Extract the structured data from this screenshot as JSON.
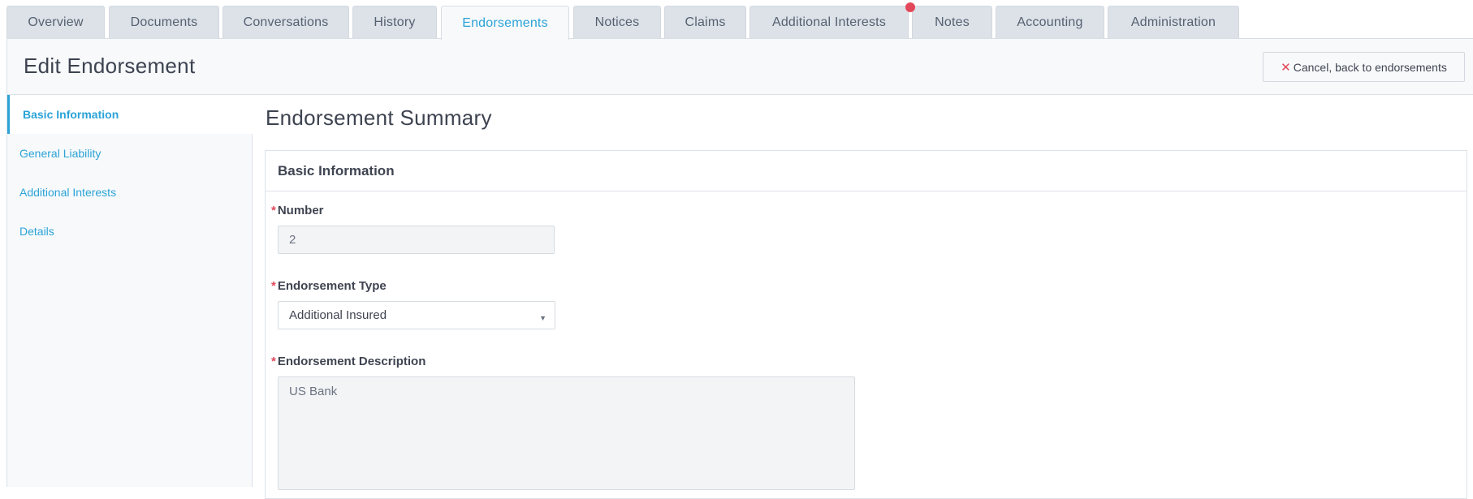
{
  "tabs": [
    {
      "label": "Overview"
    },
    {
      "label": "Documents"
    },
    {
      "label": "Conversations"
    },
    {
      "label": "History"
    },
    {
      "label": "Endorsements",
      "active": true
    },
    {
      "label": "Notices"
    },
    {
      "label": "Claims"
    },
    {
      "label": "Additional Interests",
      "notification": true
    },
    {
      "label": "Notes"
    },
    {
      "label": "Accounting"
    },
    {
      "label": "Administration"
    }
  ],
  "header": {
    "title": "Edit Endorsement",
    "cancel_icon": "close-icon",
    "cancel_label": "Cancel, back to endorsements"
  },
  "sidebar": {
    "items": [
      {
        "label": "Basic Information",
        "active": true
      },
      {
        "label": "General Liability"
      },
      {
        "label": "Additional Interests"
      },
      {
        "label": "Details"
      }
    ]
  },
  "main": {
    "title": "Endorsement Summary",
    "panel_title": "Basic Information",
    "fields": {
      "number": {
        "label": "Number",
        "value": "2",
        "required": true
      },
      "type": {
        "label": "Endorsement Type",
        "value": "Additional Insured",
        "required": true
      },
      "description": {
        "label": "Endorsement Description",
        "value": "US Bank",
        "required": true
      }
    }
  },
  "colors": {
    "accent": "#2ba3d7",
    "required": "#e2485a",
    "tab_bg": "#dde2e9",
    "notification": "#e2485a"
  }
}
